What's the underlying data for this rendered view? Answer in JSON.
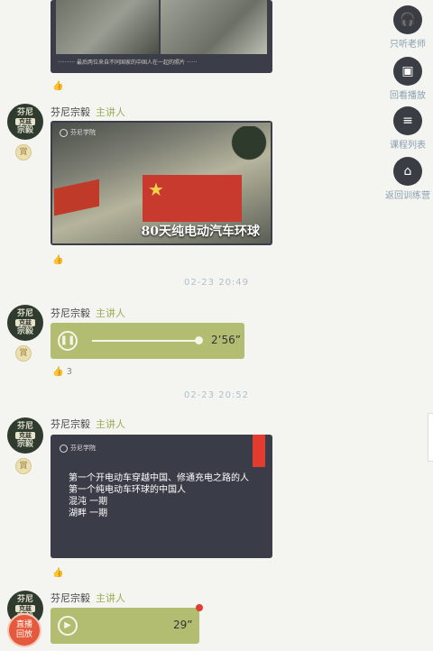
{
  "rail": [
    {
      "label": "只听老师",
      "icon": "headphones-icon",
      "glyph": "🎧"
    },
    {
      "label": "回看播放",
      "icon": "replay-icon",
      "glyph": "▣"
    },
    {
      "label": "课程列表",
      "icon": "list-icon",
      "glyph": "≡"
    },
    {
      "label": "返回训练营",
      "icon": "back-camp-icon",
      "glyph": "⌂"
    }
  ],
  "messages": [
    {
      "type": "image_caption",
      "caption": "·········· 最后两位来自不同国家的中国人在一起的照片 ······"
    },
    {
      "author": "芬尼宗毅",
      "role": "主讲人",
      "type": "image",
      "overlay_title": "80天纯电动汽车环球",
      "brand": "芬尼学院"
    },
    {
      "timestamp": "02-23 20:49"
    },
    {
      "author": "芬尼宗毅",
      "role": "主讲人",
      "type": "audio",
      "duration": "2’56”",
      "likes": "3"
    },
    {
      "timestamp": "02-23 20:52"
    },
    {
      "author": "芬尼宗毅",
      "role": "主讲人",
      "type": "slide",
      "brand": "芬尼学院",
      "lines": [
        "第一个开电动车穿越中国、修通充电之路的人",
        "第一个纯电动车环球的中国人",
        "混沌 一期",
        "湖畔 一期"
      ]
    },
    {
      "author": "芬尼宗毅",
      "role": "主讲人",
      "type": "audio",
      "duration": "29”"
    }
  ],
  "avatar": {
    "top": "Ω",
    "line1": "芬尼",
    "line2": "克兹",
    "bottom": "宗毅"
  },
  "badge_icon": "medal-icon",
  "live_badge": {
    "line1": "直播",
    "line2": "回放"
  }
}
